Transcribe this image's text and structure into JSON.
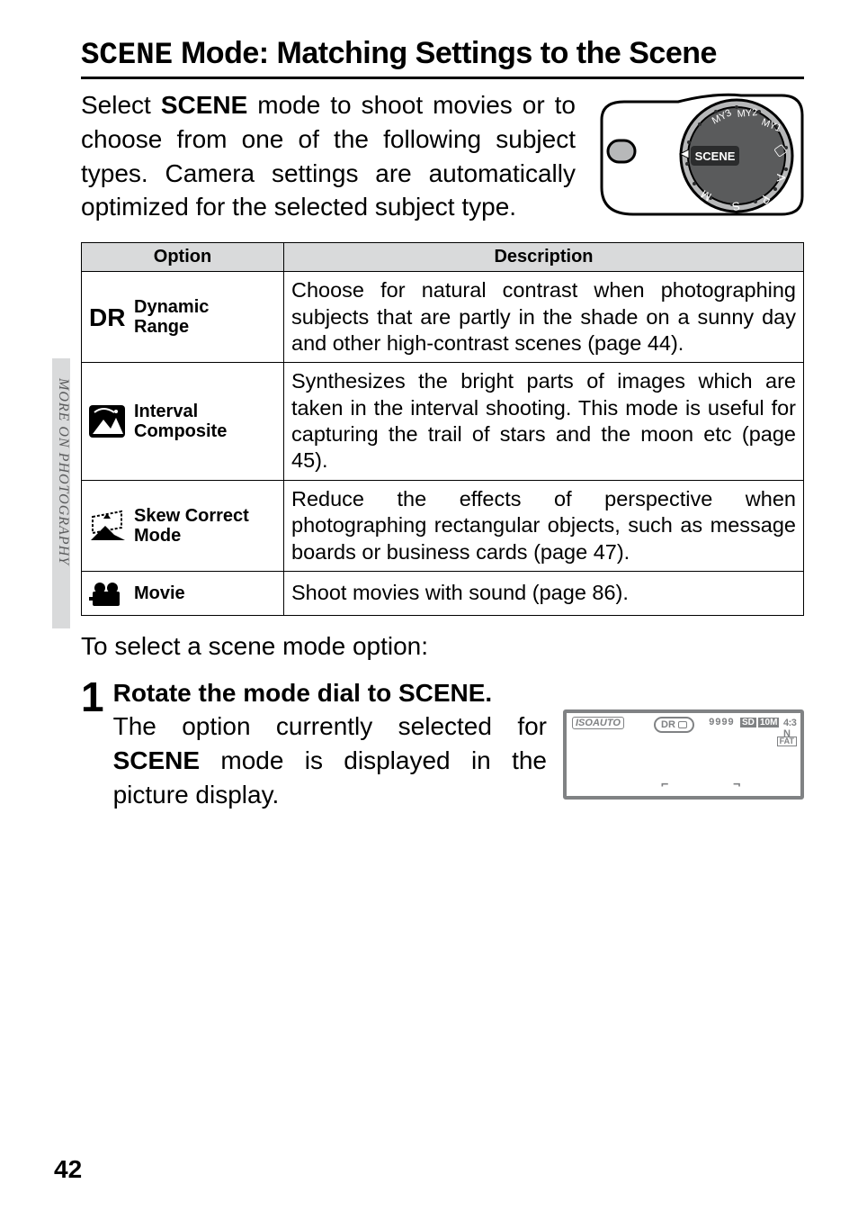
{
  "side_label": "MORE ON PHOTOGRAPHY",
  "title_prefix": "SCENE",
  "title_rest": " Mode: Matching Settings to the Scene",
  "intro_pre": "Select ",
  "intro_kw": "SCENE",
  "intro_post": " mode to shoot movies or to choose from one of the following subject types. Camera settings are automatically optimized for the selected subject type.",
  "dial_label": "SCENE",
  "table": {
    "head_option": "Option",
    "head_desc": "Description",
    "rows": [
      {
        "icon": "dr",
        "label_l1": "Dynamic",
        "label_l2": "Range",
        "desc": "Choose for natural contrast when photographing subjects that are partly in the shade on a sunny day and other high-contrast scenes (page 44)."
      },
      {
        "icon": "interval",
        "label_l1": "Interval",
        "label_l2": "Composite",
        "desc": "Synthesizes the bright parts of images which are taken in the interval shooting. This mode is useful for capturing the trail of stars and the moon etc (page 45)."
      },
      {
        "icon": "skew",
        "label_l1": "Skew Correct",
        "label_l2": "Mode",
        "desc": "Reduce the effects of perspective when photographing rectangular objects, such as message boards or business cards (page 47)."
      },
      {
        "icon": "movie",
        "label_l1": "Movie",
        "label_l2": "",
        "desc": "Shoot movies with sound (page 86)."
      }
    ]
  },
  "select_line": "To select a scene mode option:",
  "step": {
    "num": "1",
    "head_pre": "Rotate the mode dial to ",
    "head_kw": "SCENE",
    "head_post": ".",
    "body_pre": "The option currently selected for ",
    "body_kw": "SCENE",
    "body_post": " mode is displayed in the picture display."
  },
  "lcd": {
    "iso": "ISOAUTO",
    "dr": "DR",
    "count": "9999",
    "sd": "SD",
    "tenm": "10M",
    "ratio": "4:3 N",
    "fat": "FAT"
  },
  "page_number": "42"
}
